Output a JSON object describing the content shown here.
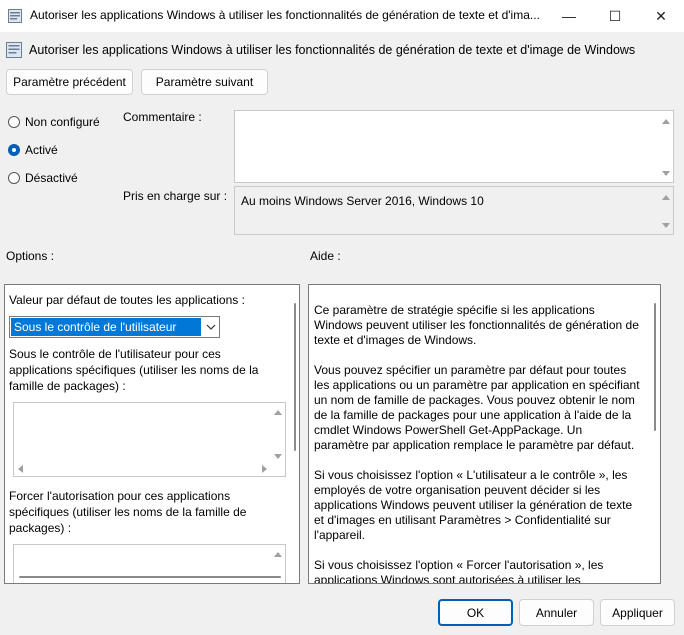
{
  "window": {
    "title": "Autoriser les applications Windows à utiliser les fonctionnalités de génération de texte et d'ima...",
    "minimize": "—",
    "maximize": "☐",
    "close": "✕"
  },
  "header": {
    "setting_name": "Autoriser les applications Windows à utiliser les fonctionnalités de génération de texte et d'image de Windows"
  },
  "nav": {
    "previous": "Paramètre précédent",
    "next": "Paramètre suivant"
  },
  "state": {
    "options": [
      {
        "label": "Non configuré",
        "checked": false
      },
      {
        "label": "Activé",
        "checked": true
      },
      {
        "label": "Désactivé",
        "checked": false
      }
    ]
  },
  "comment": {
    "label": "Commentaire :",
    "value": ""
  },
  "supported": {
    "label": "Pris en charge sur :",
    "value": "Au moins Windows Server 2016, Windows 10"
  },
  "options_section": {
    "label": "Options :",
    "default_label": "Valeur par défaut de toutes les applications :",
    "default_value": "Sous le contrôle de l'utilisateur",
    "user_control_label": "Sous le contrôle de l'utilisateur pour ces applications spécifiques (utiliser les noms de la famille de packages) :",
    "force_allow_label": "Forcer l'autorisation pour ces applications spécifiques (utiliser les noms de la famille de packages) :"
  },
  "help_section": {
    "label": "Aide :",
    "paragraphs": [
      "Ce paramètre de stratégie spécifie si les applications Windows peuvent utiliser les fonctionnalités de génération de texte et d'images de Windows.",
      "Vous pouvez spécifier un paramètre par défaut pour toutes les applications ou un paramètre par application en spécifiant un nom de famille de packages. Vous pouvez obtenir le nom de la famille de packages pour une application à l'aide de la cmdlet Windows PowerShell Get-AppPackage. Un paramètre par application remplace le paramètre par défaut.",
      "Si vous choisissez l'option « L'utilisateur a le contrôle », les employés de votre organisation peuvent décider si les applications Windows peuvent utiliser la génération de texte et d'images en utilisant Paramètres > Confidentialité sur l'appareil.",
      "Si vous choisissez l'option « Forcer l'autorisation », les applications Windows sont autorisées à utiliser les fonctionnalités de génération de texte et d'images de Windows"
    ]
  },
  "footer": {
    "ok": "OK",
    "cancel": "Annuler",
    "apply": "Appliquer"
  },
  "colors": {
    "accent": "#005fb8",
    "selection": "#0078d7"
  }
}
